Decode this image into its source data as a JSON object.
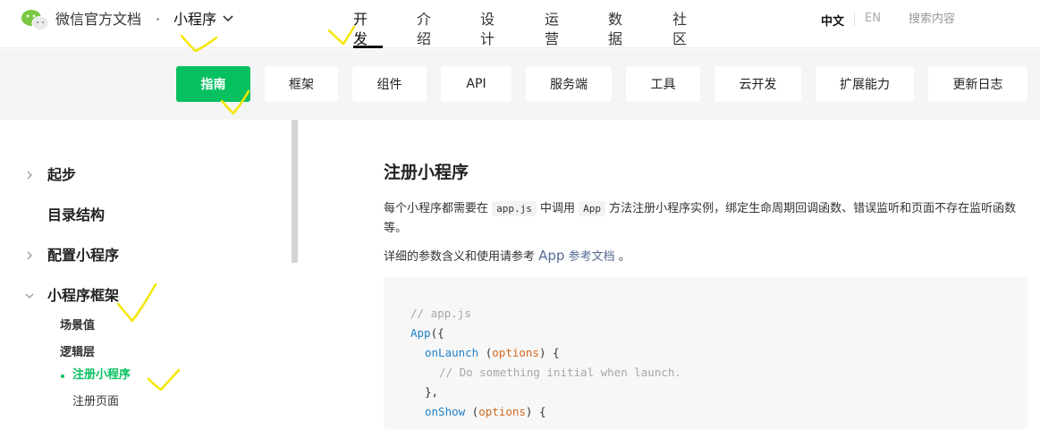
{
  "header": {
    "site_title": "微信官方文档",
    "separator": "·",
    "product": "小程序",
    "nav": [
      "开发",
      "介绍",
      "设计",
      "运营",
      "数据",
      "社区"
    ],
    "lang_zh": "中文",
    "lang_en": "EN",
    "search_placeholder": "搜索内容"
  },
  "tabs": [
    "指南",
    "框架",
    "组件",
    "API",
    "服务端",
    "工具",
    "云开发",
    "扩展能力",
    "更新日志"
  ],
  "sidebar": {
    "items": [
      "起步",
      "目录结构",
      "配置小程序",
      "小程序框架"
    ],
    "sub_items": [
      "场景值",
      "逻辑层",
      "注册小程序"
    ],
    "leaf_items": [
      "注册页面"
    ]
  },
  "content": {
    "title": "注册小程序",
    "p1_a": "每个小程序都需要在 ",
    "p1_code1": "app.js",
    "p1_b": " 中调用 ",
    "p1_code2": "App",
    "p1_c": " 方法注册小程序实例，绑定生命周期回调函数、错误监听和页面不存在监听函数等。",
    "p2_a": "详细的参数含义和使用请参考 ",
    "p2_link_a": "App",
    "p2_link_b": " 参考文档",
    "p2_end": " 。",
    "code": {
      "l1": "// app.js",
      "l2_fn": "App",
      "l2_rest": "({",
      "l3_fn": "onLaunch",
      "l3_a": " (",
      "l3_param": "options",
      "l3_b": ") {",
      "l4": "// Do something initial when launch.",
      "l5": "},",
      "l6_fn": "onShow",
      "l6_a": " (",
      "l6_param": "options",
      "l6_b": ") {"
    }
  },
  "colors": {
    "accent": "#07c160",
    "link": "#576b95",
    "annotation": "#f5e600"
  }
}
